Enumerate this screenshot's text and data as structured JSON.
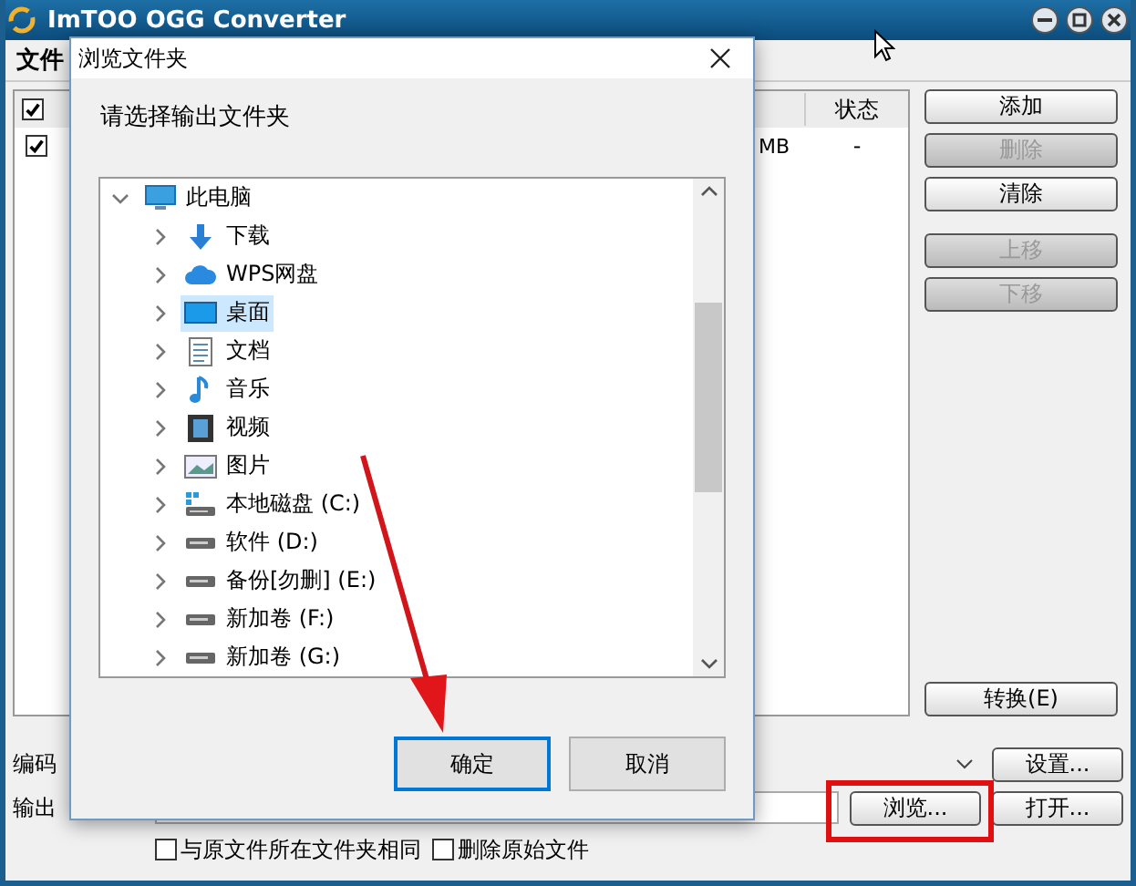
{
  "window": {
    "title": "ImTOO OGG Converter"
  },
  "menu": [
    {
      "label": "文件"
    }
  ],
  "file_list": {
    "header_checked": true,
    "columns": [
      {},
      {
        "label": "状态"
      }
    ],
    "rows": [
      {
        "checked": true,
        "cells": [
          "MB",
          "-"
        ]
      }
    ]
  },
  "button_groups": [
    [
      {
        "label": "添加",
        "disabled": false
      },
      {
        "label": "删除",
        "disabled": true
      },
      {
        "label": "清除",
        "disabled": false
      }
    ],
    [
      {
        "label": "上移",
        "disabled": true
      },
      {
        "label": "下移",
        "disabled": true
      }
    ],
    [
      {
        "label": "转换(E)",
        "disabled": false
      }
    ]
  ],
  "encoder": {
    "label": "编码",
    "settings_button": "设置..."
  },
  "output": {
    "label": "输出",
    "browse_button": "浏览...",
    "open_button": "打开..."
  },
  "options": [
    {
      "label": "与原文件所在文件夹相同",
      "checked": false
    },
    {
      "label": "删除原始文件",
      "checked": false
    }
  ],
  "dialog": {
    "title": "浏览文件夹",
    "prompt": "请选择输出文件夹",
    "tree": [
      {
        "label": "此电脑",
        "kind": "computer",
        "expanded": true,
        "selected": false,
        "children": [
          {
            "label": "下载",
            "kind": "download",
            "expanded": false,
            "selected": false
          },
          {
            "label": "WPS网盘",
            "kind": "cloud",
            "expanded": false,
            "selected": false
          },
          {
            "label": "桌面",
            "kind": "desktop",
            "expanded": false,
            "selected": true
          },
          {
            "label": "文档",
            "kind": "document",
            "expanded": false,
            "selected": false
          },
          {
            "label": "音乐",
            "kind": "music",
            "expanded": false,
            "selected": false
          },
          {
            "label": "视频",
            "kind": "video",
            "expanded": false,
            "selected": false
          },
          {
            "label": "图片",
            "kind": "picture",
            "expanded": false,
            "selected": false
          },
          {
            "label": "本地磁盘 (C:)",
            "kind": "system-drive",
            "expanded": false,
            "selected": false
          },
          {
            "label": "软件 (D:)",
            "kind": "drive",
            "expanded": false,
            "selected": false
          },
          {
            "label": "备份[勿删] (E:)",
            "kind": "drive",
            "expanded": false,
            "selected": false
          },
          {
            "label": "新加卷 (F:)",
            "kind": "drive",
            "expanded": false,
            "selected": false
          },
          {
            "label": "新加卷 (G:)",
            "kind": "drive",
            "expanded": false,
            "selected": false
          }
        ]
      }
    ],
    "ok_button": "确定",
    "cancel_button": "取消"
  }
}
